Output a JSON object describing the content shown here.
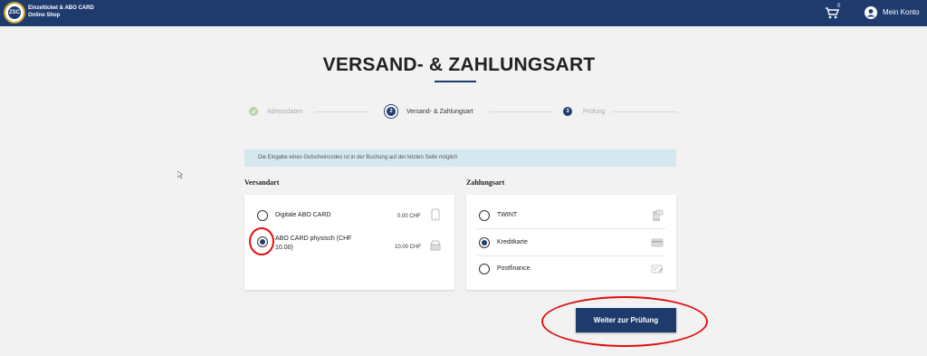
{
  "header": {
    "logo_text": "ZSC",
    "shop_title_line1": "Einzelticket & ABO CARD",
    "shop_title_line2": "Online Shop",
    "cart_count": "0",
    "account_label": "Mein Konto"
  },
  "page": {
    "title": "VERSAND- & ZAHLUNGSART"
  },
  "steps": [
    {
      "number": "✓",
      "label": "Adressdaten",
      "state": "done"
    },
    {
      "number": "2",
      "label": "Versand- & Zahlungsart",
      "state": "active"
    },
    {
      "number": "3",
      "label": "Prüfung",
      "state": "todo"
    }
  ],
  "info": {
    "banner_text": "Die Eingabe eines Gutscheincodes ist in der Buchung auf der letzten Seite möglich"
  },
  "shipping": {
    "heading": "Versandart",
    "options": [
      {
        "label": "Digitale ABO CARD",
        "price": "0.00 CHF",
        "icon": "mobile-icon",
        "selected": false
      },
      {
        "label": "ABO CARD physisch (CHF 10.00)",
        "price": "10.00 CHF",
        "icon": "mailbox-icon",
        "selected": true
      }
    ]
  },
  "payment": {
    "heading": "Zahlungsart",
    "options": [
      {
        "label": "TWINT",
        "icon": "twint-icon",
        "selected": false
      },
      {
        "label": "Kreditkarte",
        "icon": "credit-card-icon",
        "selected": true
      },
      {
        "label": "Postfinance",
        "icon": "postfinance-card-icon",
        "selected": false
      }
    ]
  },
  "actions": {
    "next_label": "Weiter zur Prüfung"
  },
  "colors": {
    "brand": "#1f3b6e",
    "annotation": "#e01010",
    "banner": "#d5e7ef"
  }
}
